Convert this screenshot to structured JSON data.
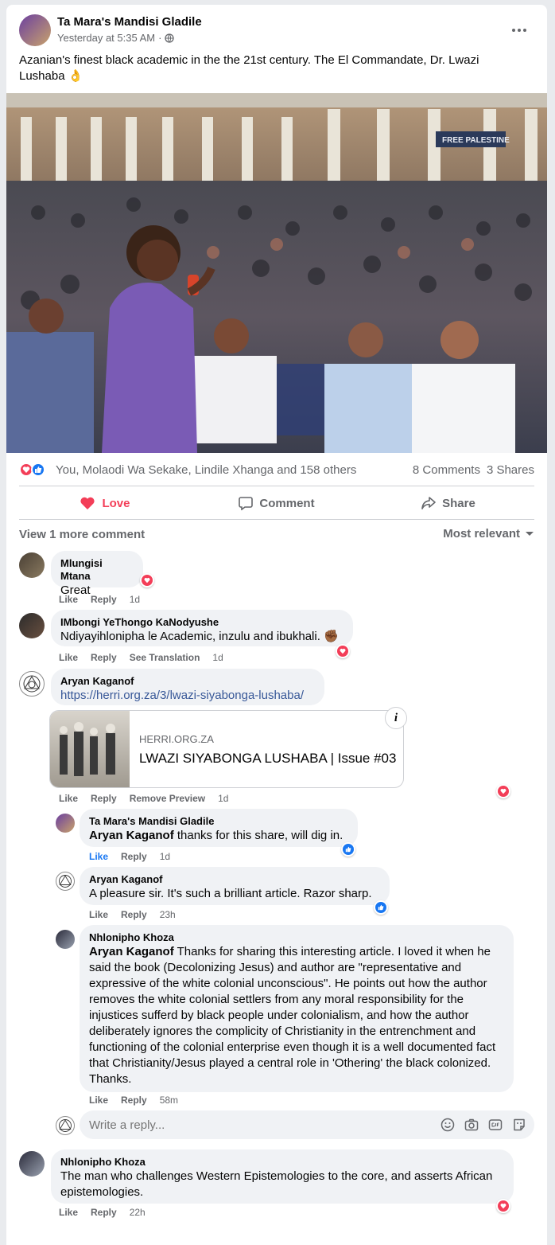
{
  "post": {
    "author": "Ta Mara's Mandisi Gladile",
    "time": "Yesterday at 5:35 AM",
    "separator": "·",
    "text": "Azanian's finest black academic in the the 21st century. The El Commandate, Dr. Lwazi Lushaba 👌",
    "photo_banner": "FREE PALESTINE",
    "reactions_summary": "You, Molaodi Wa Sekake, Lindile Xhanga and 158 others",
    "comments_count": "8 Comments",
    "shares_count": "3 Shares"
  },
  "action_bar": {
    "love": "Love",
    "comment": "Comment",
    "share": "Share"
  },
  "comments_header": {
    "view_more": "View 1 more comment",
    "sort": "Most relevant"
  },
  "comments": [
    {
      "name": "Mlungisi Mtana",
      "text": "Great",
      "like": "Like",
      "reply": "Reply",
      "time": "1d"
    },
    {
      "name": "IMbongi YeThongo KaNodyushe",
      "text": "Ndiyayihlonipha le Academic, inzulu and ibukhali. ✊🏾",
      "like": "Like",
      "reply": "Reply",
      "extra": "See Translation",
      "time": "1d"
    },
    {
      "name": "Aryan Kaganof",
      "link": "https://herri.org.za/3/lwazi-siyabonga-lushaba/",
      "preview_domain": "HERRI.ORG.ZA",
      "preview_title": "LWAZI SIYABONGA LUSHABA | Issue #03",
      "info": "i",
      "like": "Like",
      "reply": "Reply",
      "extra": "Remove Preview",
      "time": "1d"
    }
  ],
  "replies": [
    {
      "name": "Ta Mara's Mandisi Gladile",
      "tag": "Aryan Kaganof",
      "text": " thanks for this share, will dig in.",
      "like": "Like",
      "reply": "Reply",
      "time": "1d"
    },
    {
      "name": "Aryan Kaganof",
      "text": "A pleasure sir. It's such a brilliant article. Razor sharp.",
      "like": "Like",
      "reply": "Reply",
      "time": "23h"
    },
    {
      "name": "Nhlonipho Khoza",
      "tag": "Aryan Kaganof",
      "text": " Thanks for sharing this interesting article. I loved it when he said the book (Decolonizing Jesus) and author are \"representative and expressive of the white colonial unconscious\". He points out how the author removes the white colonial settlers from any moral responsibility for the injustices sufferd by black people under colonialism, and how the author deliberately ignores the complicity of Christianity in the entrenchment and functioning of the colonial enterprise even though it is a well documented fact that Christianity/Jesus played a central role in 'Othering' the black colonized. Thanks.",
      "like": "Like",
      "reply": "Reply",
      "time": "58m"
    }
  ],
  "reply_box": {
    "placeholder": "Write a reply..."
  },
  "last_comment": {
    "name": "Nhlonipho Khoza",
    "text": "The man who challenges Western Epistemologies to the core, and asserts African epistemologies.",
    "like": "Like",
    "reply": "Reply",
    "time": "22h"
  },
  "icons": [
    "more-icon",
    "globe-icon",
    "heart-icon",
    "like-icon",
    "comment-icon",
    "share-icon",
    "dropdown-icon",
    "emoji-icon",
    "camera-icon",
    "gif-icon",
    "sticker-icon",
    "info-icon"
  ],
  "colors": {
    "love": "#f33e58",
    "like": "#1877f2",
    "link": "#385898",
    "meta": "#65676b",
    "bubble": "#f0f2f5"
  }
}
